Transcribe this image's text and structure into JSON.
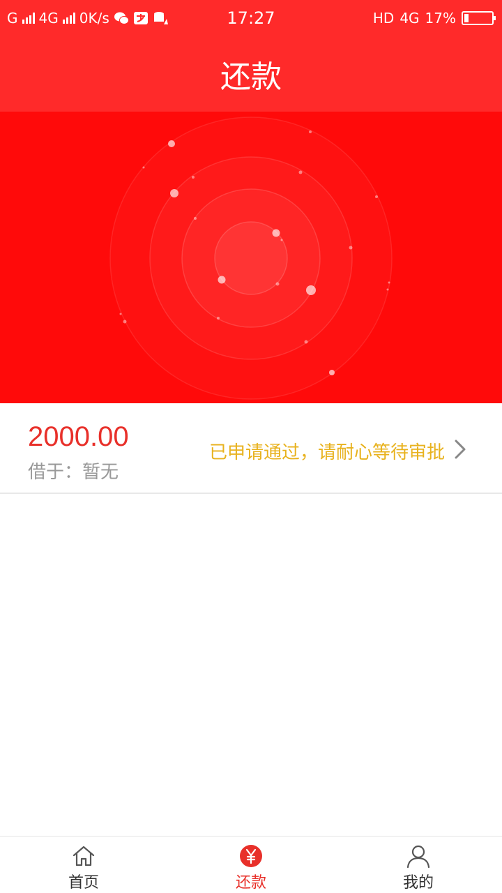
{
  "status_bar": {
    "carrier1": "G",
    "carrier2": "4G",
    "speed": "0K/s",
    "time": "17:27",
    "hd": "HD",
    "network": "4G",
    "battery": "17%",
    "battery_level": 0.17
  },
  "header": {
    "title": "还款"
  },
  "loan": {
    "amount": "2000.00",
    "borrow_info": "借于：暂无",
    "status": "已申请通过，请耐心等待审批"
  },
  "tabs": [
    {
      "label": "首页",
      "icon": "home-icon",
      "active": false
    },
    {
      "label": "还款",
      "icon": "yuan-icon",
      "active": true
    },
    {
      "label": "我的",
      "icon": "user-icon",
      "active": false
    }
  ],
  "colors": {
    "header_bg": "#ff2a2a",
    "hero_bg": "#ff0a0a",
    "accent": "#e8302a",
    "status_text": "#e8b21e",
    "muted_text": "#999999"
  }
}
